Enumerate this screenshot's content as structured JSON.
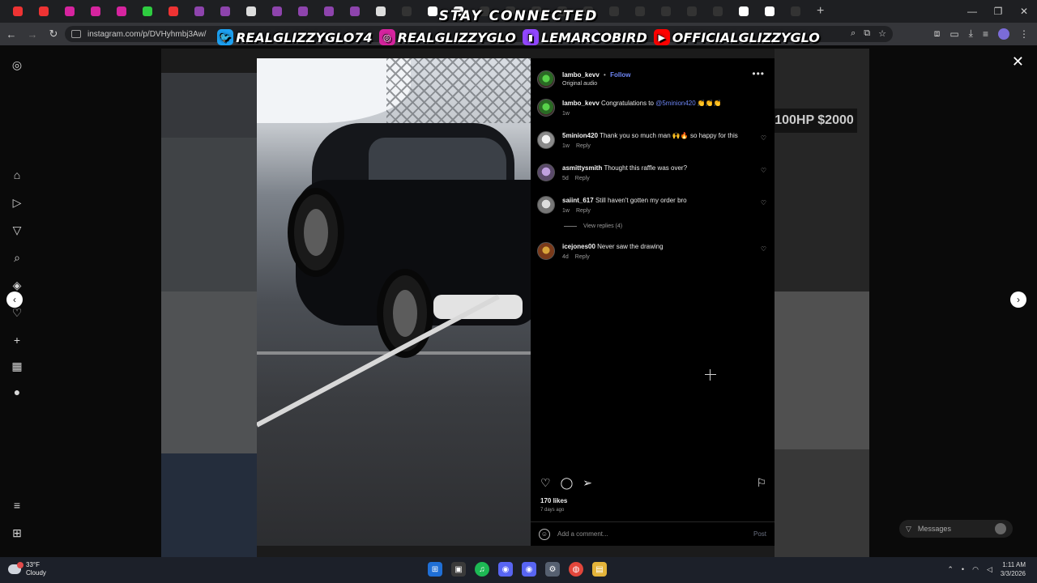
{
  "browser": {
    "tab_count": 36,
    "address": "instagram.com/p/DVHyhmbj3Aw/",
    "window_controls": [
      "—",
      "❐",
      "✕"
    ],
    "new_tab": "+"
  },
  "overlay": {
    "heading": "STAY CONNECTED",
    "socials": [
      {
        "platform": "twitter-icon",
        "handle": "REALGLIZZYGLO74",
        "color": "#1da1f2"
      },
      {
        "platform": "instagram-icon",
        "handle": "REALGLIZZYGLO",
        "color": "#d6249f"
      },
      {
        "platform": "twitch-icon",
        "handle": "LEMARCOBIRD",
        "color": "#9146ff"
      },
      {
        "platform": "youtube-icon",
        "handle": "OFFICIALGLIZZYGLO",
        "color": "#ff0000"
      }
    ]
  },
  "background": {
    "tile_text": "100HP $2000"
  },
  "post": {
    "author": "lambo_kevv",
    "follow_label": "Follow",
    "audio_label": "Original audio",
    "more_label": "•••",
    "likes": "170 likes",
    "posted": "7 days ago",
    "comment_placeholder": "Add a comment...",
    "post_label": "Post",
    "comments": [
      {
        "user": "lambo_kevv",
        "text": "Congratulations to ",
        "mention": "@5minion420",
        "emoji": " 👏👏👏",
        "age": "1w",
        "reply": "",
        "avatar": "avatar",
        "heart": false
      },
      {
        "user": "5minion420",
        "text": "Thank you so much man 🙌🔥 so happy for this",
        "mention": "",
        "emoji": "",
        "age": "1w",
        "reply": "Reply",
        "avatar": "avatar pale",
        "heart": true
      },
      {
        "user": "asmittysmith",
        "text": "Thought this raffle was over?",
        "mention": "",
        "emoji": "",
        "age": "5d",
        "reply": "Reply",
        "avatar": "avatar mixed",
        "heart": true
      },
      {
        "user": "saiint_617",
        "text": "Still haven't gotten my order bro",
        "mention": "",
        "emoji": "",
        "age": "1w",
        "reply": "Reply",
        "avatar": "avatar gray",
        "heart": true
      },
      {
        "user": "icejones00",
        "text": "Never saw the drawing",
        "mention": "",
        "emoji": "",
        "age": "4d",
        "reply": "Reply",
        "avatar": "avatar brown",
        "heart": true
      }
    ],
    "view_replies": "View replies (4)"
  },
  "messages": {
    "label": "Messages"
  },
  "taskbar": {
    "temp": "33°F",
    "condition": "Cloudy",
    "time": "1:11 AM",
    "date": "3/3/2026"
  },
  "colors": {
    "accent": "#6d86f5",
    "panel_bg": "#000000",
    "taskbar_bg": "#1c2029"
  }
}
